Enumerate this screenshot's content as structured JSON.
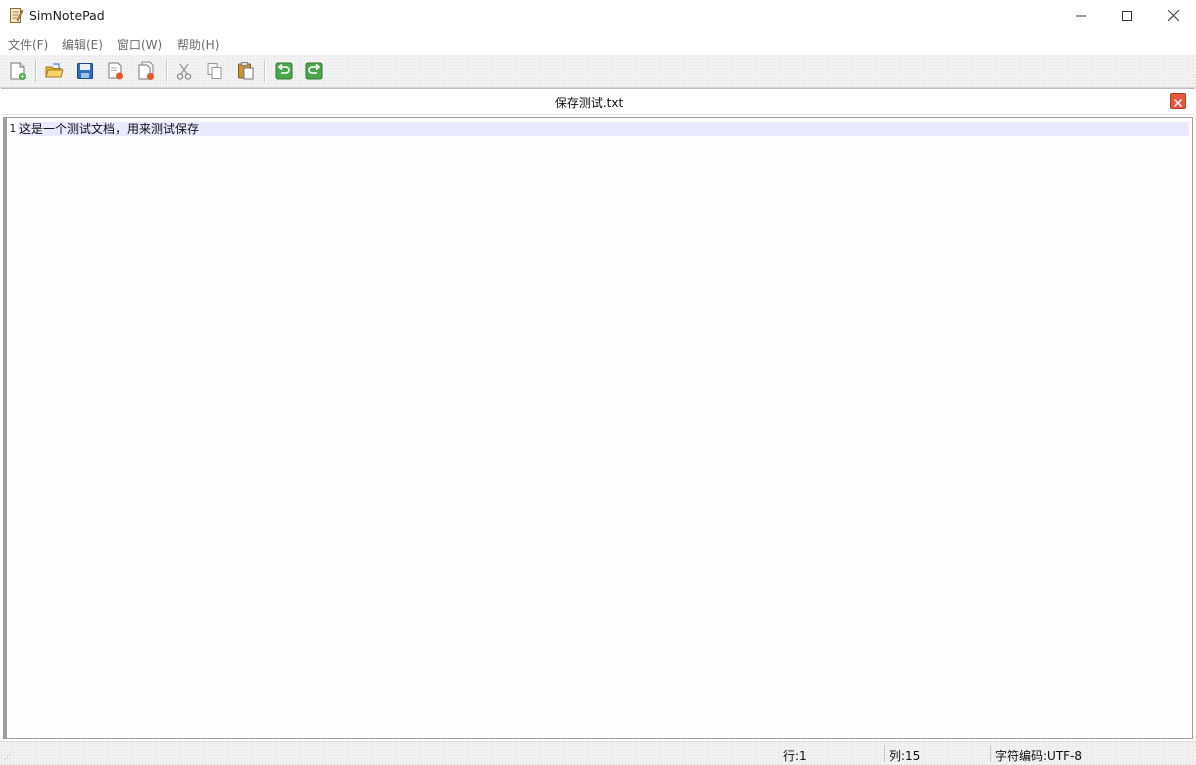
{
  "app": {
    "title": "SimNotePad",
    "icon": "notepad-icon"
  },
  "window_controls": {
    "minimize": "minimize-icon",
    "maximize": "maximize-icon",
    "close": "close-icon"
  },
  "menu": {
    "items": [
      {
        "label": "文件(F)"
      },
      {
        "label": "编辑(E)"
      },
      {
        "label": "窗口(W)"
      },
      {
        "label": "帮助(H)"
      }
    ]
  },
  "toolbar": {
    "buttons": [
      {
        "icon": "new-file-icon"
      },
      {
        "icon": "open-folder-icon"
      },
      {
        "icon": "save-icon"
      },
      {
        "icon": "close-file-icon"
      },
      {
        "icon": "close-all-icon"
      },
      {
        "icon": "cut-icon"
      },
      {
        "icon": "copy-icon"
      },
      {
        "icon": "paste-icon"
      },
      {
        "icon": "undo-icon"
      },
      {
        "icon": "redo-icon"
      }
    ]
  },
  "document": {
    "title": "保存测试.txt",
    "close_icon": "close-tab-icon",
    "lines": [
      {
        "number": "1",
        "text": "这是一个测试文档，用来测试保存"
      }
    ]
  },
  "status": {
    "row": "行:1",
    "col": "列:15",
    "encoding": "字符编码:UTF-8"
  },
  "colors": {
    "current_line_highlight": "#e9e9ff",
    "doc_close_button": "#e8563b"
  }
}
